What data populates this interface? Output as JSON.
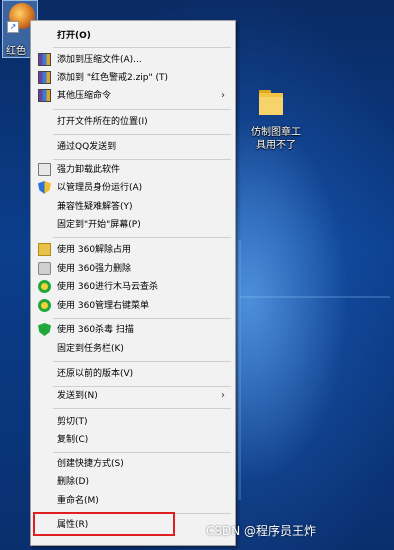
{
  "desktop": {
    "icons": [
      {
        "label": "红色"
      },
      {
        "label_line1": "仿制图章工",
        "label_line2": "具用不了"
      }
    ]
  },
  "context_menu": {
    "items": [
      {
        "label": "打开(O)"
      },
      {
        "label": "添加到压缩文件(A)..."
      },
      {
        "label": "添加到 \"红色警戒2.zip\" (T)"
      },
      {
        "label": "其他压缩命令"
      },
      {
        "label": "打开文件所在的位置(I)"
      },
      {
        "label": "通过QQ发送到"
      },
      {
        "label": "强力卸载此软件"
      },
      {
        "label": "以管理员身份运行(A)"
      },
      {
        "label": "兼容性疑难解答(Y)"
      },
      {
        "label": "固定到\"开始\"屏幕(P)"
      },
      {
        "label": "使用 360解除占用"
      },
      {
        "label": "使用 360强力删除"
      },
      {
        "label": "使用 360进行木马云查杀"
      },
      {
        "label": "使用 360管理右键菜单"
      },
      {
        "label": "使用 360杀毒 扫描"
      },
      {
        "label": "固定到任务栏(K)"
      },
      {
        "label": "还原以前的版本(V)"
      },
      {
        "label": "发送到(N)"
      },
      {
        "label": "剪切(T)"
      },
      {
        "label": "复制(C)"
      },
      {
        "label": "创建快捷方式(S)"
      },
      {
        "label": "删除(D)"
      },
      {
        "label": "重命名(M)"
      },
      {
        "label": "属性(R)"
      }
    ],
    "submenu_arrow": "›"
  },
  "watermark": "CSDN @程序员王炸",
  "colors": {
    "desktop_bg": "#0b3e8c",
    "menu_bg": "#f2f2f2",
    "highlight_border": "#e02020"
  }
}
